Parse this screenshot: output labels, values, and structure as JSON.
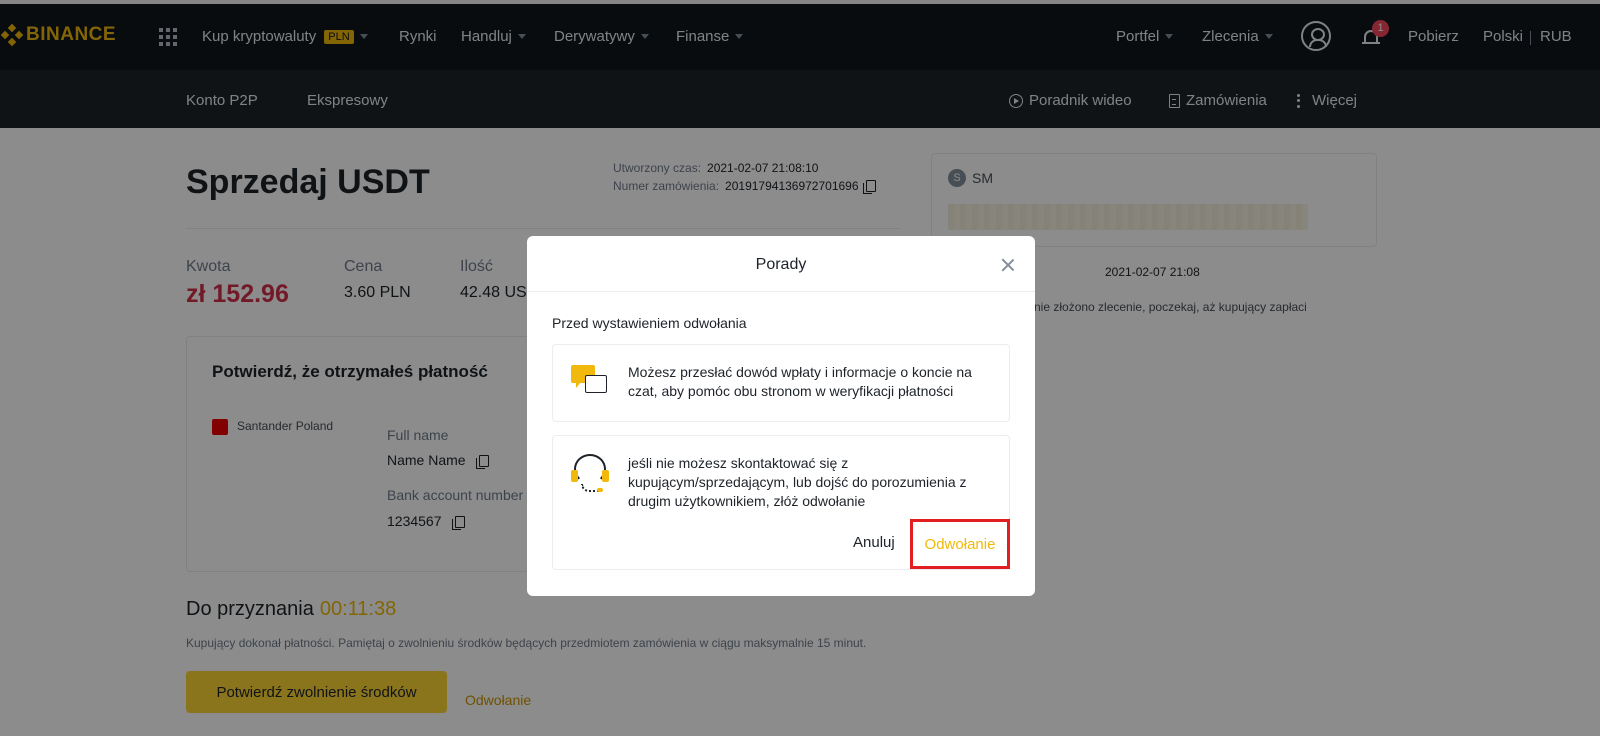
{
  "nav": {
    "logo": "BINANCE",
    "buy_crypto": "Kup kryptowaluty",
    "buy_crypto_badge": "PLN",
    "markets": "Rynki",
    "trade": "Handluj",
    "derivatives": "Derywatywy",
    "finance": "Finanse",
    "wallet": "Portfel",
    "orders": "Zlecenia",
    "notification_count": "1",
    "download": "Pobierz",
    "language": "Polski",
    "currency": "RUB"
  },
  "subnav": {
    "p2p_account": "Konto P2P",
    "express": "Ekspresowy",
    "video_guide": "Poradnik wideo",
    "orders": "Zamówienia",
    "more": "Więcej"
  },
  "order": {
    "title": "Sprzedaj USDT",
    "created_label": "Utworzony czas:",
    "created_value": "2021-02-07 21:08:10",
    "order_no_label": "Numer zamówienia:",
    "order_no_value": "20191794136972701696",
    "amount_label": "Kwota",
    "amount_value": "zł 152.96",
    "price_label": "Cena",
    "price_value": "3.60 PLN",
    "quantity_label": "Ilość",
    "quantity_value": "42.48 USDT"
  },
  "payment": {
    "title": "Potwierdź, że otrzymałeś płatność",
    "bank": "Santander Poland",
    "fullname_label": "Full name",
    "fullname_value": "Name Name",
    "account_label": "Bank account number",
    "account_value": "1234567"
  },
  "release": {
    "title": "Do przyznania",
    "timer": "00:11:38",
    "desc": "Kupujący dokonał płatności. Pamiętaj o zwolnieniu środków będących przedmiotem zamówienia w ciągu maksymalnie 15 minut.",
    "confirm_button": "Potwierdź zwolnienie środków",
    "appeal_link": "Odwołanie"
  },
  "side": {
    "counterparty_initial": "S",
    "counterparty": "SM",
    "date": "2021-02-07 21:08",
    "note": "nie złożono zlecenie, poczekaj, aż kupujący zapłaci"
  },
  "modal": {
    "title": "Porady",
    "subtitle": "Przed wystawieniem odwołania",
    "tip1": "Możesz przesłać dowód wpłaty i informacje o koncie na czat, aby pomóc obu stronom w weryfikacji płatności",
    "tip2": "jeśli nie możesz skontaktować się z kupującym/sprzedającym, lub dojść do porozumienia z drugim użytkownikiem, złóż odwołanie",
    "cancel": "Anuluj",
    "appeal": "Odwołanie"
  },
  "colors": {
    "brand": "#f0b90b",
    "nav_bg": "#12161c",
    "subnav_bg": "#1e2329",
    "amount_red": "#cf304a",
    "highlight_border": "#e02020"
  }
}
